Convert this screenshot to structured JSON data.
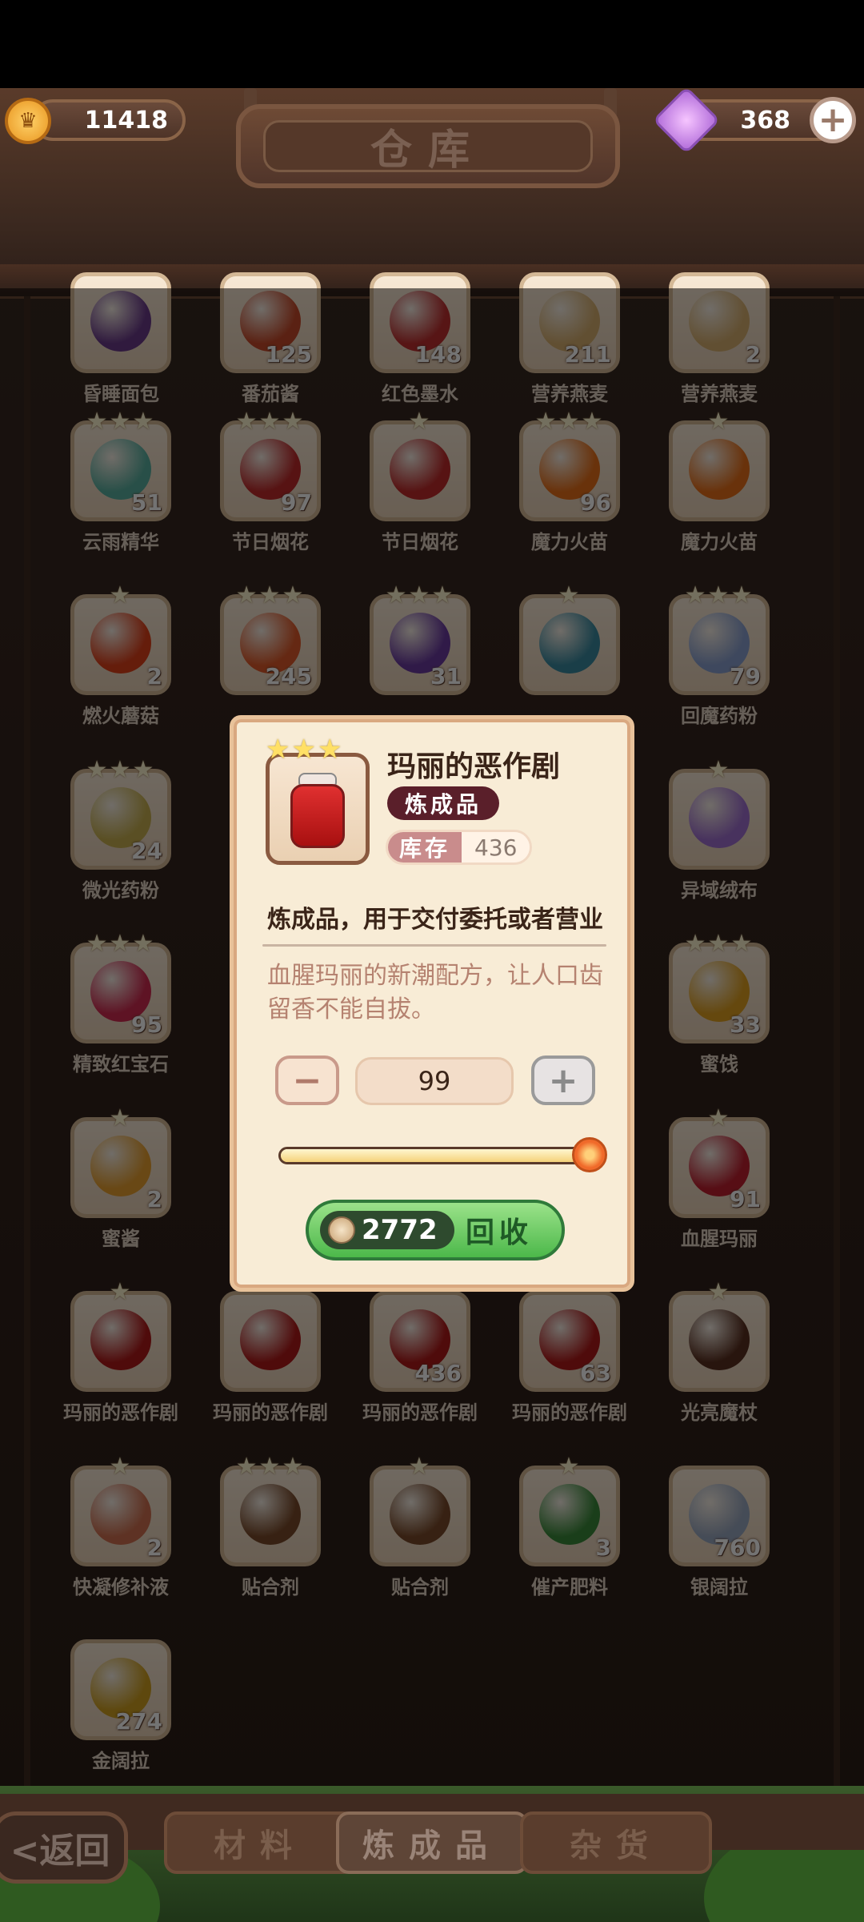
{
  "header": {
    "coins": "11418",
    "gems": "368",
    "title": "仓库"
  },
  "grid": {
    "items": [
      {
        "label": "昏睡面包",
        "count": "",
        "stars": "",
        "color": "#6a3a8a"
      },
      {
        "label": "番茄酱",
        "count": "125",
        "stars": "",
        "color": "#c84a2a"
      },
      {
        "label": "红色墨水",
        "count": "148",
        "stars": "",
        "color": "#c03030"
      },
      {
        "label": "营养燕麦",
        "count": "211",
        "stars": "",
        "color": "#d8b070"
      },
      {
        "label": "营养燕麦",
        "count": "2",
        "stars": "",
        "color": "#d8b070"
      },
      {
        "label": "云雨精华",
        "count": "51",
        "stars": "★★★",
        "color": "#5ab0a0"
      },
      {
        "label": "节日烟花",
        "count": "97",
        "stars": "★★★",
        "color": "#c02a2a"
      },
      {
        "label": "节日烟花",
        "count": "",
        "stars": "★",
        "color": "#c02a2a"
      },
      {
        "label": "魔力火苗",
        "count": "96",
        "stars": "★★★",
        "color": "#e8701a"
      },
      {
        "label": "魔力火苗",
        "count": "",
        "stars": "★",
        "color": "#e8701a"
      },
      {
        "label": "燃火蘑菇",
        "count": "2",
        "stars": "★",
        "color": "#e0401a"
      },
      {
        "label": "",
        "count": "245",
        "stars": "★★★",
        "color": "#e05a2a"
      },
      {
        "label": "",
        "count": "31",
        "stars": "★★★",
        "color": "#6a3aa0"
      },
      {
        "label": "",
        "count": "",
        "stars": "★",
        "color": "#3a8aa0"
      },
      {
        "label": "回魔药粉",
        "count": "79",
        "stars": "★★★",
        "color": "#8aa0d0"
      },
      {
        "label": "微光药粉",
        "count": "24",
        "stars": "★★★",
        "color": "#c8b050"
      },
      {
        "label": "",
        "count": "",
        "stars": "",
        "color": "#000000"
      },
      {
        "label": "",
        "count": "",
        "stars": "",
        "color": "#000000"
      },
      {
        "label": "",
        "count": "",
        "stars": "",
        "color": "#000000"
      },
      {
        "label": "异域绒布",
        "count": "",
        "stars": "★",
        "color": "#a070d0"
      },
      {
        "label": "精致红宝石",
        "count": "95",
        "stars": "★★★",
        "color": "#d02a50"
      },
      {
        "label": "",
        "count": "",
        "stars": "",
        "color": "#000000"
      },
      {
        "label": "",
        "count": "",
        "stars": "",
        "color": "#000000"
      },
      {
        "label": "",
        "count": "",
        "stars": "",
        "color": "#000000"
      },
      {
        "label": "蜜饯",
        "count": "33",
        "stars": "★★★",
        "color": "#e0a020"
      },
      {
        "label": "蜜酱",
        "count": "2",
        "stars": "★",
        "color": "#e8a030"
      },
      {
        "label": "",
        "count": "",
        "stars": "",
        "color": "#000000"
      },
      {
        "label": "",
        "count": "",
        "stars": "",
        "color": "#000000"
      },
      {
        "label": "",
        "count": "",
        "stars": "",
        "color": "#000000"
      },
      {
        "label": "血腥玛丽",
        "count": "91",
        "stars": "★",
        "color": "#c02030"
      },
      {
        "label": "玛丽的恶作剧",
        "count": "",
        "stars": "★",
        "color": "#b01a1a"
      },
      {
        "label": "玛丽的恶作剧",
        "count": "",
        "stars": "",
        "color": "#b01a1a"
      },
      {
        "label": "玛丽的恶作剧",
        "count": "436",
        "stars": "",
        "color": "#b01a1a"
      },
      {
        "label": "玛丽的恶作剧",
        "count": "63",
        "stars": "",
        "color": "#b01a1a"
      },
      {
        "label": "光亮魔杖",
        "count": "",
        "stars": "★",
        "color": "#5a3020"
      },
      {
        "label": "快凝修补液",
        "count": "2",
        "stars": "★",
        "color": "#d07050"
      },
      {
        "label": "贴合剂",
        "count": "",
        "stars": "★★★",
        "color": "#7a4a2a"
      },
      {
        "label": "贴合剂",
        "count": "",
        "stars": "★",
        "color": "#7a4a2a"
      },
      {
        "label": "催产肥料",
        "count": "3",
        "stars": "★",
        "color": "#3a8a3a"
      },
      {
        "label": "银阔拉",
        "count": "760",
        "stars": "",
        "color": "#9aa8c0"
      },
      {
        "label": "金阔拉",
        "count": "274",
        "stars": "",
        "color": "#d0a020"
      }
    ]
  },
  "modal": {
    "stars": "★★★",
    "name": "玛丽的恶作剧",
    "category": "炼成品",
    "stock_label": "库存",
    "stock_value": "436",
    "usage": "炼成品，用于交付委托或者营业",
    "flavor": "血腥玛丽的新潮配方，让人口齿留香不能自拔。",
    "quantity": "99",
    "minus": "−",
    "plus": "+",
    "slider_fraction": 1.0,
    "price": "2772",
    "recycle_label": "回收"
  },
  "nav": {
    "back": "<返回",
    "tabs": [
      {
        "label": "材料",
        "active": false
      },
      {
        "label": "炼成品",
        "active": true
      },
      {
        "label": "杂货",
        "active": false
      }
    ]
  }
}
